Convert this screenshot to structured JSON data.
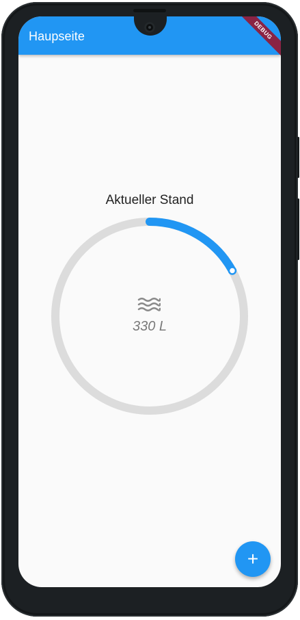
{
  "app_bar": {
    "title": "Haupseite",
    "debug_banner": "DEBUG",
    "color": "#2196f3"
  },
  "gauge": {
    "title": "Aktueller Stand",
    "value_label": "330 L",
    "progress_fraction": 0.17,
    "track_color": "#dcdcdc",
    "progress_color": "#2196f3",
    "icon": "water-waves-icon"
  },
  "fab": {
    "symbol": "+",
    "icon": "add-icon"
  }
}
